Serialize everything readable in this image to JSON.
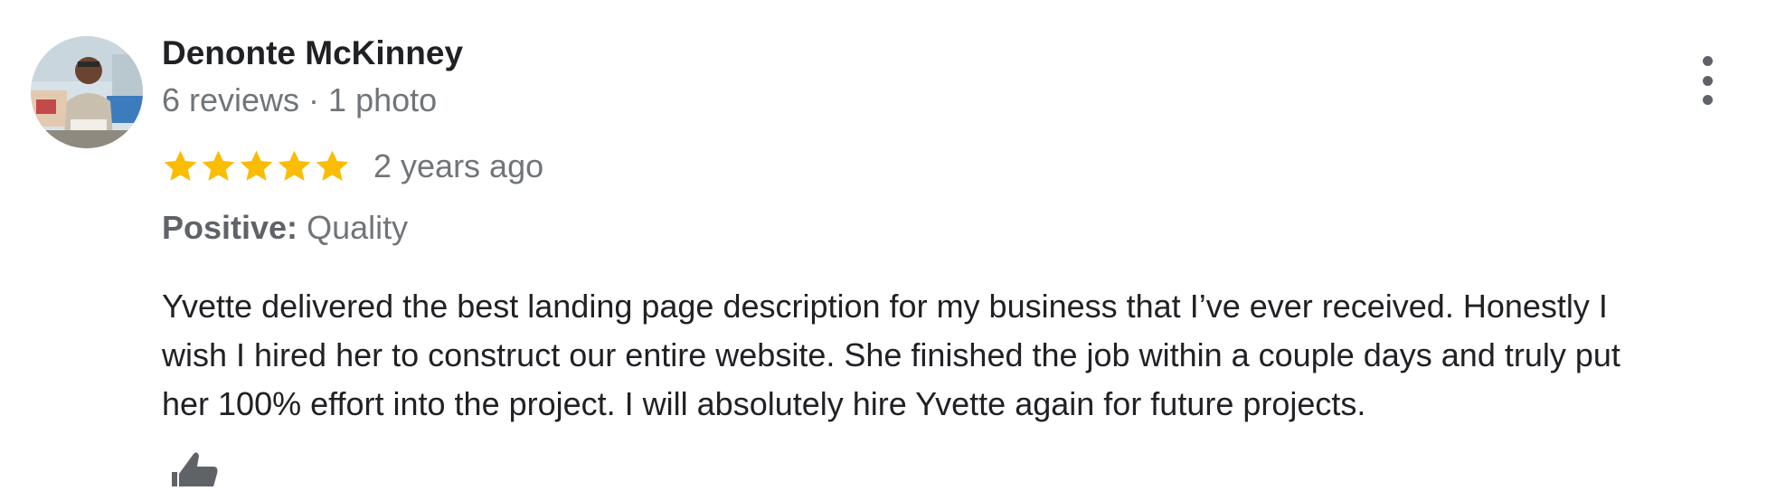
{
  "reviewer": {
    "name": "Denonte McKinney",
    "meta": "6 reviews · 1 photo"
  },
  "rating": {
    "stars": 5,
    "max": 5,
    "time": "2 years ago"
  },
  "attributes": {
    "label": "Positive:",
    "value": "Quality"
  },
  "review": {
    "lines": [
      "Yvette delivered the best landing page description for my business that I’ve ever received. Honestly I",
      "wish I hired her to construct our entire website. She finished the job within a couple days and truly put",
      "her 100% effort into the project. I will absolutely hire Yvette again for future projects."
    ]
  },
  "icons": {
    "more": "more-vert-icon",
    "like": "thumb-up-icon",
    "star": "star-icon"
  },
  "colors": {
    "star": "#fbbc04",
    "secondary_text": "#70757a",
    "icon_gray": "#5f6368"
  }
}
